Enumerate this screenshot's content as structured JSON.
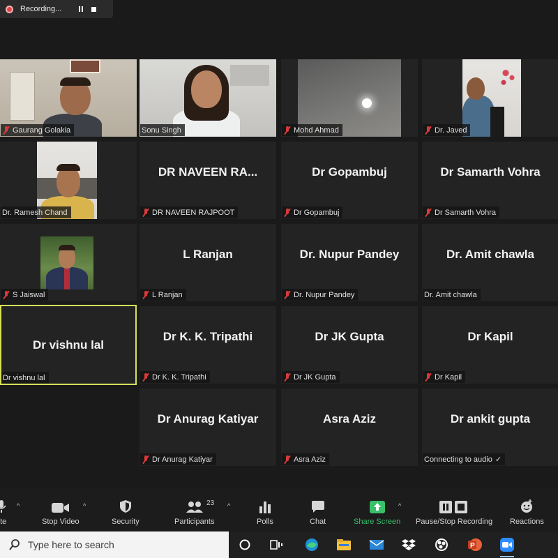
{
  "recording": {
    "label": "Recording..."
  },
  "tiles": [
    {
      "name": "Gaurang Golakia",
      "muted": true
    },
    {
      "name": "Sonu Singh",
      "muted": false
    },
    {
      "name": "Mohd Ahmad",
      "muted": true
    },
    {
      "name": "Dr. Javed",
      "muted": true
    },
    {
      "name": "Dr. Ramesh Chand",
      "muted": false
    },
    {
      "display": "DR  NAVEEN  RA...",
      "name": "DR NAVEEN RAJPOOT",
      "muted": true
    },
    {
      "display": "Dr Gopambuj",
      "name": "Dr Gopambuj",
      "muted": true
    },
    {
      "display": "Dr Samarth Vohra",
      "name": "Dr Samarth Vohra",
      "muted": true
    },
    {
      "name": "S Jaiswal",
      "muted": true
    },
    {
      "display": "L Ranjan",
      "name": "L Ranjan",
      "muted": true
    },
    {
      "display": "Dr. Nupur Pandey",
      "name": "Dr. Nupur Pandey",
      "muted": true
    },
    {
      "display": "Dr. Amit chawla",
      "name": "Dr. Amit chawla",
      "muted": false
    },
    {
      "display": "Dr vishnu lal",
      "name": "Dr vishnu lal",
      "muted": false,
      "active": true
    },
    {
      "display": "Dr K. K. Tripathi",
      "name": "Dr K. K. Tripathi",
      "muted": true
    },
    {
      "display": "Dr JK Gupta",
      "name": "Dr JK Gupta",
      "muted": true
    },
    {
      "display": "Dr Kapil",
      "name": "Dr Kapil",
      "muted": true
    },
    {
      "display": "Dr Anurag Katiyar",
      "name": "Dr Anurag Katiyar",
      "muted": true
    },
    {
      "display": "Asra Aziz",
      "name": "Asra Aziz",
      "muted": true
    },
    {
      "display": "Dr ankit gupta",
      "name": "Connecting to audio",
      "status_icon": "check-icon",
      "muted": false
    }
  ],
  "toolbar": {
    "mute": "ute",
    "stop_video": "Stop Video",
    "security": "Security",
    "participants": "Participants",
    "participants_count": "23",
    "polls": "Polls",
    "chat": "Chat",
    "share_screen": "Share Screen",
    "pause_stop_recording": "Pause/Stop Recording",
    "reactions": "Reactions",
    "share_color": "#38c06a"
  },
  "taskbar": {
    "search_placeholder": "Type here to search",
    "apps": [
      "search-circle-icon",
      "task-view-icon",
      "edge-icon",
      "file-explorer-icon",
      "mail-icon",
      "dropbox-icon",
      "obs-icon",
      "powerpoint-icon",
      "zoom-icon"
    ]
  }
}
